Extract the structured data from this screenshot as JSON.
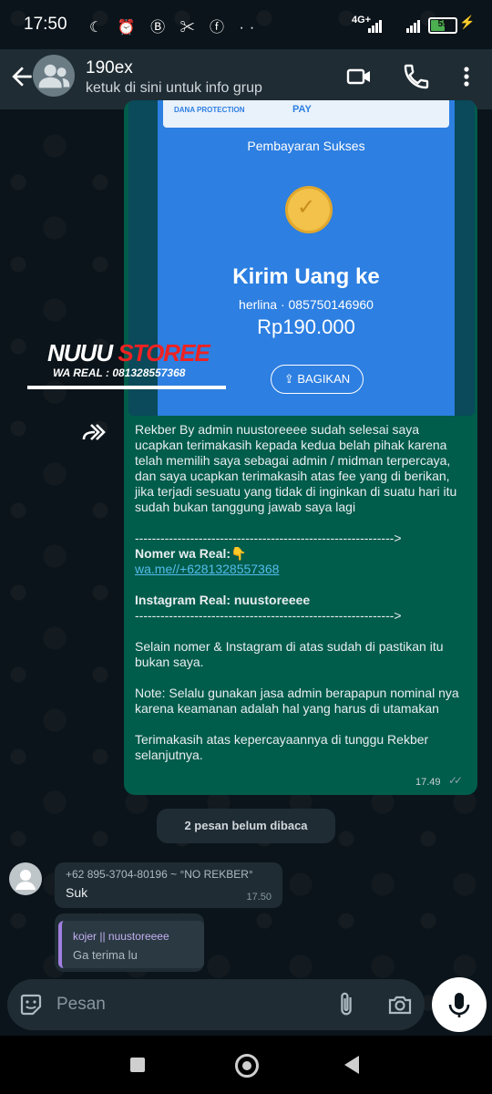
{
  "status": {
    "time": "17:50",
    "left_icons": "☾ ⏰ Ⓑ ✂ ⓕ ··",
    "network": "4G+",
    "battery": "55",
    "battery_pct": 0.55
  },
  "header": {
    "group_name": "190ex",
    "subtitle": "ketuk di sini untuk info grup"
  },
  "image_message": {
    "protection": "DANA PROTECTION",
    "pay": "PAY",
    "title": "Pembayaran Sukses",
    "headline": "Kirim Uang ke",
    "recipient": "herlina · 085750146960",
    "amount": "Rp190.000",
    "share_button": "BAGIKAN",
    "watermark_brand_a": "NUUU",
    "watermark_brand_b": " STOREE",
    "watermark_wa": "WA REAL : 081328557368"
  },
  "outgoing_message": {
    "para1": "Rekber By admin nuustoreeee sudah selesai saya ucapkan terimakasih kepada kedua belah pihak karena telah memilih saya sebagai admin / midman terpercaya, dan saya ucapkan terimakasih atas fee yang di berikan, jika terjadi sesuatu yang tidak di inginkan di suatu hari itu sudah bukan tanggung jawab saya lagi",
    "divider1": "------------------------------------------------------------->",
    "wa_label": "Nomer wa Real:👇",
    "wa_link": "wa.me//+6281328557368",
    "ig_label": "Instagram Real: nuustoreeee",
    "divider2": "------------------------------------------------------------->",
    "para2": "Selain nomer & Instagram di atas sudah di pastikan itu bukan saya.",
    "para3": "Note: Selalu gunakan jasa admin berapapun nominal nya karena keamanan adalah hal yang harus di utamakan",
    "para4": "Terimakasih atas kepercayaannya di tunggu Rekber selanjutnya.",
    "time": "17.49",
    "ticks": "✓✓"
  },
  "unread_banner": "2 pesan belum dibaca",
  "incoming_message": {
    "sender": "+62 895-3704-80196  ~ °NO REKBER°",
    "text": "Suk",
    "time": "17.50"
  },
  "incoming_quote": {
    "name": "kojer || nuustoreeee",
    "text": "Ga terima lu"
  },
  "composer": {
    "placeholder": "Pesan"
  },
  "icons": {
    "back": "arrow-left-icon",
    "video": "video-call-icon",
    "call": "phone-icon",
    "menu": "more-vert-icon",
    "emoji": "sticker-icon",
    "attach": "paperclip-icon",
    "camera": "camera-icon",
    "mic": "mic-icon",
    "forward": "forward-icon"
  },
  "colors": {
    "header_bg": "#1f2c34",
    "outgoing_bubble": "#005c4b",
    "incoming_bubble": "#1f2c34",
    "link": "#53bdeb",
    "dana_blue": "#2d7fe1"
  }
}
